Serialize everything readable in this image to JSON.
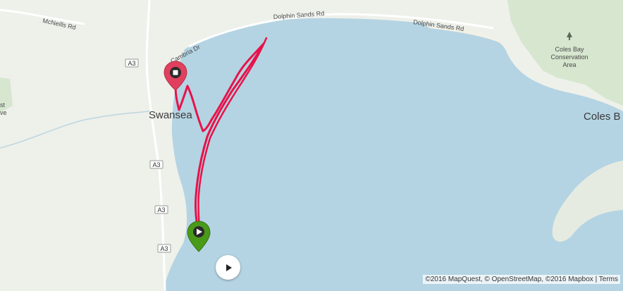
{
  "map": {
    "labels": {
      "town": "Swansea",
      "road_mcneills": "McNeills Rd",
      "road_dolphin_1": "Dolphin Sands Rd",
      "road_dolphin_2": "Dolphin Sands Rd",
      "road_cambria": "Cambria Dr",
      "coles_bay_town": "Coles B",
      "conservation_line1": "Coles Bay",
      "conservation_line2": "Conservation",
      "conservation_line3": "Area",
      "left_edge_fragment1": "st",
      "left_edge_fragment2": "ve"
    },
    "road_shields": [
      "A3",
      "A3",
      "A3",
      "A3"
    ],
    "colors": {
      "water": "#b4d4e3",
      "land": "#eef0ea",
      "park": "#d6e6cf",
      "track": "#e8124a",
      "start_marker": "#4a9a1a",
      "end_marker": "#e0405e"
    }
  },
  "route": {
    "start_marker": {
      "icon": "play-icon",
      "color": "#4a9a1a"
    },
    "end_marker": {
      "icon": "stop-icon",
      "color": "#e0405e"
    }
  },
  "controls": {
    "play_button": {
      "icon": "play-icon"
    }
  },
  "attribution": {
    "text": "©2016 MapQuest, © OpenStreetMap, ©2016 Mapbox | Terms"
  }
}
